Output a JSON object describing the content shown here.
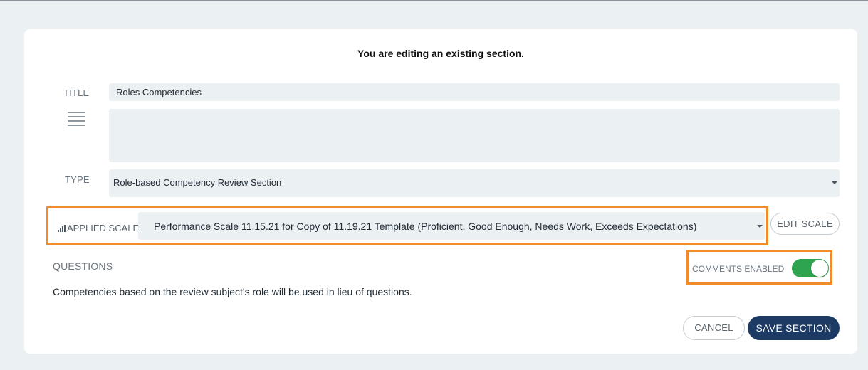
{
  "heading": "You are editing an existing section.",
  "title": {
    "label": "TITLE",
    "value": "Roles Competencies"
  },
  "description": {
    "value": ""
  },
  "type": {
    "label": "TYPE",
    "selected": "Role-based Competency Review Section"
  },
  "scale": {
    "label": "APPLIED SCALE",
    "selected": "Performance Scale 11.15.21 for Copy of 11.19.21 Template (Proficient, Good Enough, Needs Work, Exceeds Expectations)",
    "edit_label": "EDIT SCALE"
  },
  "questions": {
    "label": "QUESTIONS",
    "info": "Competencies based on the review subject's role will be used in lieu of questions."
  },
  "comments": {
    "label": "COMMENTS ENABLED",
    "enabled": true
  },
  "actions": {
    "cancel": "CANCEL",
    "save": "SAVE SECTION"
  },
  "colors": {
    "highlight": "#f28c28",
    "toggle_on": "#2ea44f",
    "primary_button": "#1c3a63",
    "field_bg": "#ebf0f3"
  },
  "icons": {
    "description": "menu-lines-icon",
    "scale": "signal-bars-icon",
    "dropdown": "caret-down-icon"
  }
}
